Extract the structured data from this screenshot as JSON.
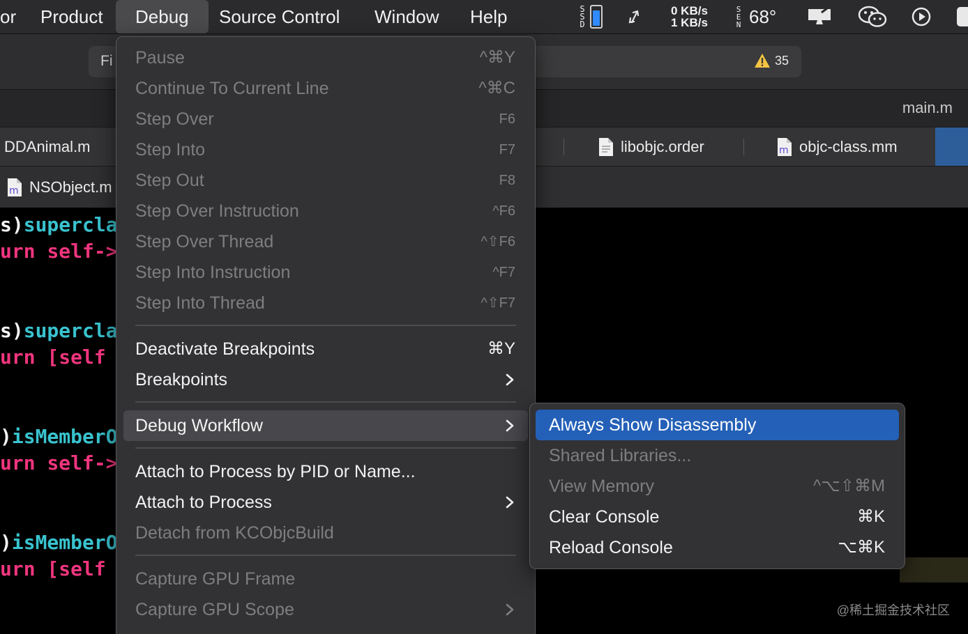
{
  "menubar": {
    "items": [
      {
        "label": "or"
      },
      {
        "label": "Product"
      },
      {
        "label": "Debug"
      },
      {
        "label": "Source Control"
      },
      {
        "label": "Window"
      },
      {
        "label": "Help"
      }
    ],
    "status": {
      "ssd_label": "SSD",
      "battery_level": 0.75,
      "network_up": "0 KB/s",
      "network_down": "1 KB/s",
      "wind_label": "SEN",
      "temperature": "68°"
    }
  },
  "toolbar": {
    "find_text": "Fi",
    "warning_count": "35"
  },
  "tabs": {
    "right_title": "main.m",
    "row": [
      {
        "label": "DDAnimal.m"
      },
      {
        "label": "libobjc.order"
      },
      {
        "label": "objc-class.mm"
      }
    ],
    "secondary": {
      "label": "NSObject.m"
    },
    "file_badge": "m"
  },
  "code_lines": [
    {
      "p1": "s)",
      "p2": "supercla",
      "p3": ""
    },
    {
      "p1": "urn ",
      "p2": "",
      "p3": "self->"
    },
    {
      "p1": "s)",
      "p2": "supercla",
      "p3": ""
    },
    {
      "p1": "urn [",
      "p2": "",
      "p3": "self"
    },
    {
      "p1": ")",
      "p2": "isMemberO",
      "p3": ""
    },
    {
      "p1": "urn ",
      "p2": "",
      "p3": "self->"
    },
    {
      "p1": ")",
      "p2": "isMemberO",
      "p3": ""
    },
    {
      "p1": "urn [",
      "p2": "",
      "p3": "self"
    }
  ],
  "debug_menu": {
    "items": [
      {
        "label": "Pause",
        "shortcut": "^⌘Y"
      },
      {
        "label": "Continue To Current Line",
        "shortcut": "^⌘C"
      },
      {
        "label": "Step Over",
        "shortcut": "F6"
      },
      {
        "label": "Step Into",
        "shortcut": "F7"
      },
      {
        "label": "Step Out",
        "shortcut": "F8"
      },
      {
        "label": "Step Over Instruction",
        "shortcut": "^F6"
      },
      {
        "label": "Step Over Thread",
        "shortcut": "^⇧F6"
      },
      {
        "label": "Step Into Instruction",
        "shortcut": "^F7"
      },
      {
        "label": "Step Into Thread",
        "shortcut": "^⇧F7"
      },
      {
        "label": "Deactivate Breakpoints",
        "shortcut": "⌘Y"
      },
      {
        "label": "Breakpoints",
        "shortcut": ""
      },
      {
        "label": "Debug Workflow",
        "shortcut": ""
      },
      {
        "label": "Attach to Process by PID or Name...",
        "shortcut": ""
      },
      {
        "label": "Attach to Process",
        "shortcut": ""
      },
      {
        "label": "Detach from KCObjcBuild",
        "shortcut": ""
      },
      {
        "label": "Capture GPU Frame",
        "shortcut": ""
      },
      {
        "label": "Capture GPU Scope",
        "shortcut": ""
      }
    ]
  },
  "workflow_submenu": {
    "items": [
      {
        "label": "Always Show Disassembly",
        "shortcut": ""
      },
      {
        "label": "Shared Libraries...",
        "shortcut": ""
      },
      {
        "label": "View Memory",
        "shortcut": "^⌥⇧⌘M"
      },
      {
        "label": "Clear Console",
        "shortcut": "⌘K"
      },
      {
        "label": "Reload Console",
        "shortcut": "⌥⌘K"
      }
    ]
  },
  "watermark": "@稀土掘金技术社区",
  "colors": {
    "menu_bg": "#323134",
    "selection": "#2460b7",
    "hover": "#48474b",
    "code_cyan": "#39c3cf",
    "code_pink": "#f0357e",
    "warning": "#f5c542"
  },
  "icons": [
    "warning-icon",
    "file-icon",
    "chevron-right-icon",
    "wechat-icon",
    "play-icon",
    "sync-arrows-icon",
    "display-icon"
  ]
}
